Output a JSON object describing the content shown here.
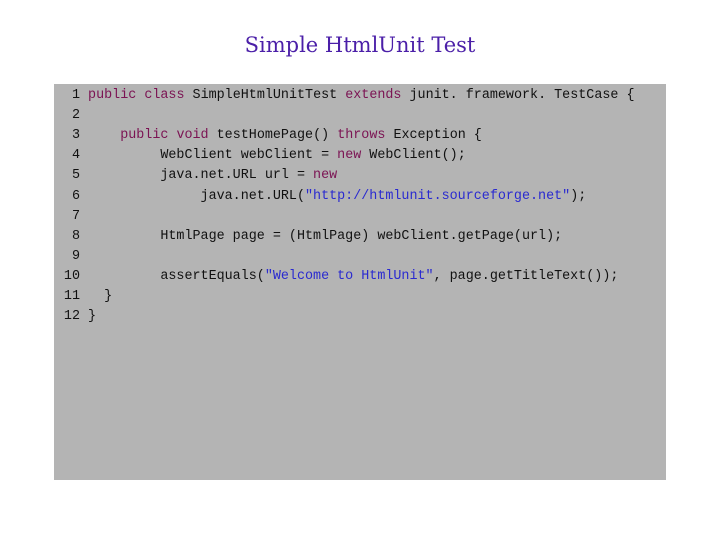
{
  "title": "Simple HtmlUnit Test",
  "colors": {
    "title": "#4b1fa8",
    "code_background": "#b4b4b4",
    "keyword": "#7b1353",
    "string": "#2a2ad0",
    "text": "#111111"
  },
  "code": {
    "language": "java",
    "lines": [
      {
        "number": "1",
        "tokens": [
          {
            "t": " "
          },
          {
            "t": "public",
            "k": "kw"
          },
          {
            "t": " "
          },
          {
            "t": "class",
            "k": "kw"
          },
          {
            "t": " SimpleHtmlUnitTest "
          },
          {
            "t": "extends",
            "k": "kw"
          },
          {
            "t": " junit. framework. TestCase {"
          }
        ]
      },
      {
        "number": "2",
        "tokens": []
      },
      {
        "number": "3",
        "tokens": [
          {
            "t": "     "
          },
          {
            "t": "public",
            "k": "kw"
          },
          {
            "t": " "
          },
          {
            "t": "void",
            "k": "kw"
          },
          {
            "t": " testHomePage() "
          },
          {
            "t": "throws",
            "k": "kw"
          },
          {
            "t": " Exception {"
          }
        ]
      },
      {
        "number": "4",
        "tokens": [
          {
            "t": "          WebClient webClient = "
          },
          {
            "t": "new",
            "k": "kw"
          },
          {
            "t": " WebClient();"
          }
        ]
      },
      {
        "number": "5",
        "tokens": [
          {
            "t": "          java.net.URL url = "
          },
          {
            "t": "new",
            "k": "kw"
          }
        ]
      },
      {
        "number": "6",
        "tokens": [
          {
            "t": "               java.net.URL("
          },
          {
            "t": "\"http://htmlunit.sourceforge.net\"",
            "k": "str"
          },
          {
            "t": ");"
          }
        ]
      },
      {
        "number": "7",
        "tokens": []
      },
      {
        "number": "8",
        "tokens": [
          {
            "t": "          HtmlPage page = (HtmlPage) webClient.getPage(url);"
          }
        ]
      },
      {
        "number": "9",
        "tokens": []
      },
      {
        "number": "10",
        "tokens": [
          {
            "t": "          assertEquals("
          },
          {
            "t": "\"Welcome to HtmlUnit\"",
            "k": "str"
          },
          {
            "t": ", page.getTitleText());"
          }
        ]
      },
      {
        "number": "11",
        "tokens": [
          {
            "t": "   }"
          }
        ]
      },
      {
        "number": "12",
        "tokens": [
          {
            "t": " }"
          }
        ]
      }
    ]
  }
}
